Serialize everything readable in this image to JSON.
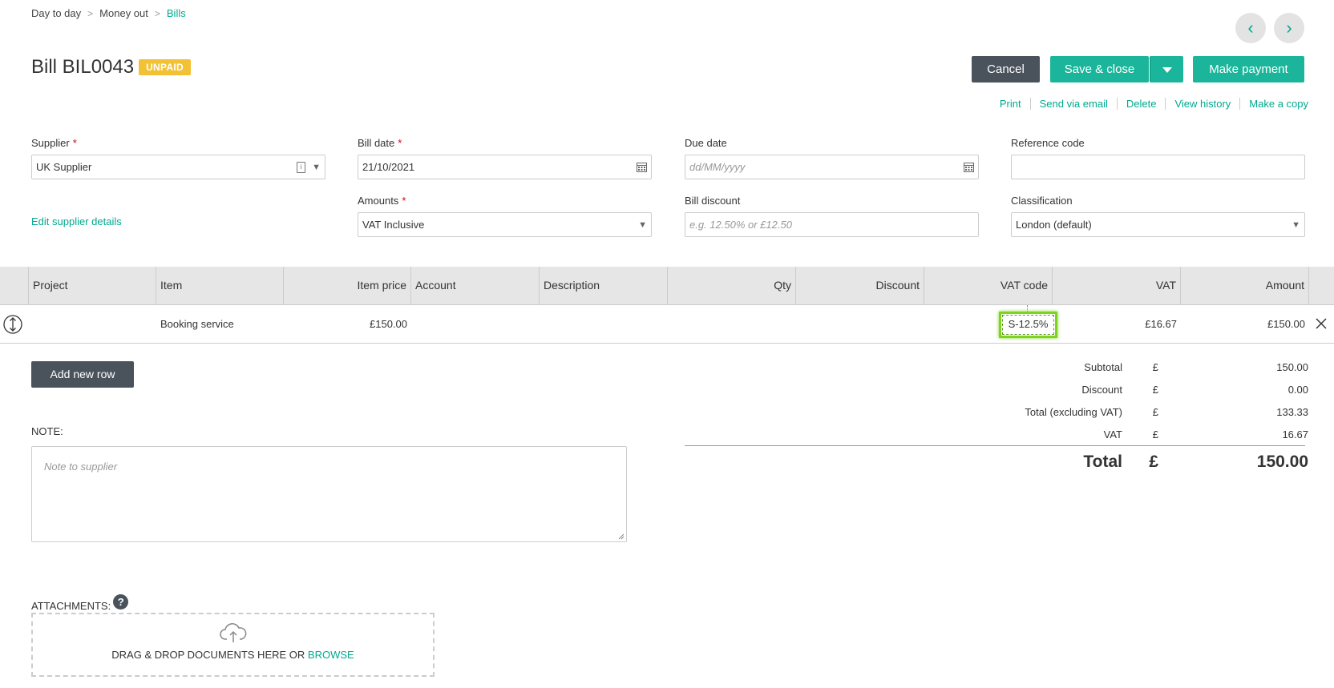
{
  "breadcrumb": [
    "Day to day",
    "Money out",
    "Bills"
  ],
  "nav": {
    "prev_icon": "‹",
    "next_icon": "›"
  },
  "bill": {
    "title": "Bill BIL0043",
    "status": "UNPAID"
  },
  "buttons": {
    "cancel": "Cancel",
    "save_close": "Save & close",
    "make_payment": "Make payment",
    "add_row": "Add new row"
  },
  "actions": [
    "Print",
    "Send via email",
    "Delete",
    "View history",
    "Make a copy"
  ],
  "form": {
    "supplier_label": "Supplier",
    "supplier_value": "UK Supplier",
    "edit_supplier": "Edit supplier details",
    "bill_date_label": "Bill date",
    "bill_date_value": "21/10/2021",
    "due_date_label": "Due date",
    "due_date_placeholder": "dd/MM/yyyy",
    "reference_label": "Reference code",
    "amounts_label": "Amounts",
    "amounts_value": "VAT Inclusive",
    "discount_label": "Bill discount",
    "discount_placeholder": "e.g. 12.50% or £12.50",
    "classification_label": "Classification",
    "classification_value": "London (default)"
  },
  "table": {
    "headers": [
      "Project",
      "Item",
      "Item price",
      "Account",
      "Description",
      "Qty",
      "Discount",
      "VAT code",
      "VAT",
      "Amount"
    ],
    "row": {
      "project": "",
      "item": "Booking service",
      "item_price": "£150.00",
      "account": "",
      "description": "",
      "qty": "",
      "discount": "",
      "vat_code": "S-12.5%",
      "vat": "£16.67",
      "amount": "£150.00"
    }
  },
  "totals": {
    "currency": "£",
    "subtotal_label": "Subtotal",
    "subtotal": "150.00",
    "discount_label": "Discount",
    "discount": "0.00",
    "total_ex_label": "Total (excluding VAT)",
    "total_ex": "133.33",
    "vat_label": "VAT",
    "vat": "16.67",
    "total_label": "Total",
    "total": "150.00"
  },
  "note": {
    "label": "NOTE:",
    "placeholder": "Note to supplier"
  },
  "attachments": {
    "label": "ATTACHMENTS:",
    "drop_text": "DRAG & DROP DOCUMENTS HERE OR",
    "browse": "BROWSE"
  },
  "colors": {
    "accent": "#1ab59a",
    "dark_button": "#4a525c",
    "unpaid_badge": "#f2c135",
    "highlight": "#7ed321"
  }
}
